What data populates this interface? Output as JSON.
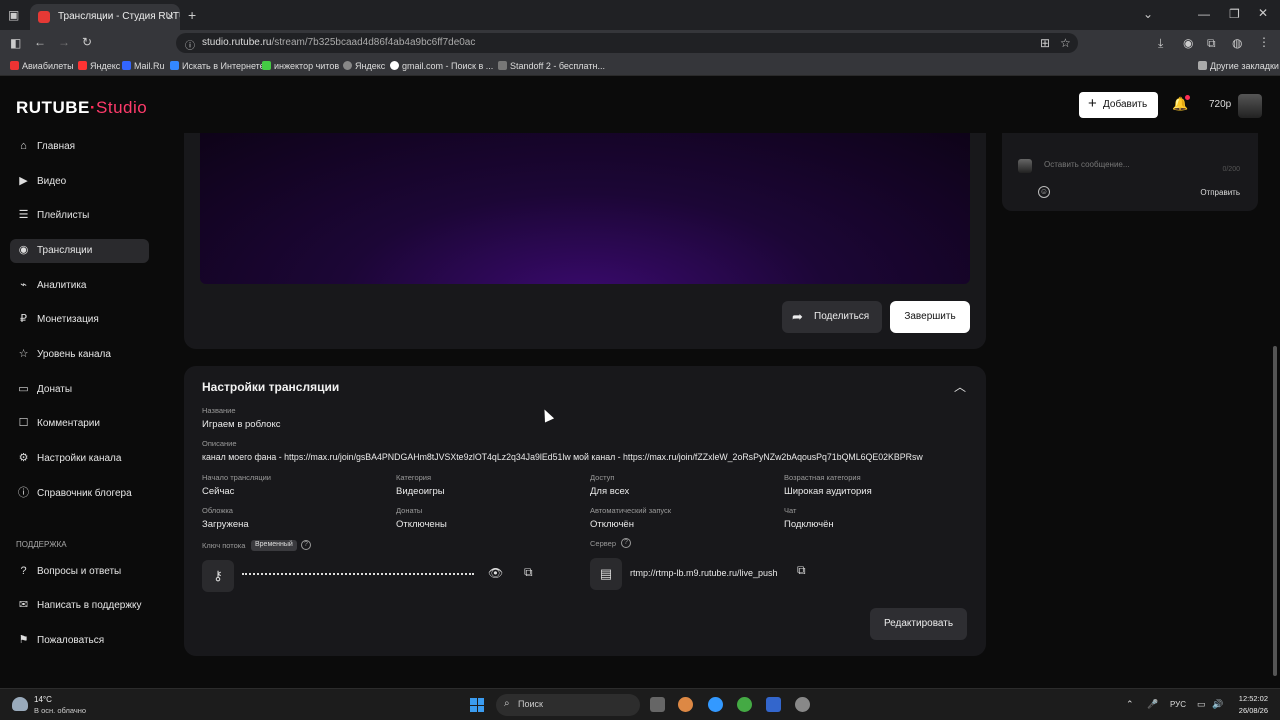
{
  "browser": {
    "tab_title": "Трансляции - Студия RUTUBE",
    "url_domain": "studio.rutube.ru",
    "url_path": "/stream/7b325bcaad4d86f4ab4a9bc6ff7de0ac",
    "bookmarks": [
      "Авиабилеты",
      "Яндекс",
      "Mail.Ru",
      "Искать в Интернете",
      "инжектор читов",
      "Яндекс",
      "gmail.com - Поиск в ...",
      "Standoff 2 - бесплатн..."
    ],
    "other_bookmarks": "Другие закладки"
  },
  "app": {
    "logo_main": "RUTUBE",
    "logo_dot": "·",
    "logo_studio": "Studio",
    "add_label": "Добавить",
    "quality": "720p"
  },
  "sidebar": {
    "items": [
      {
        "label": "Главная",
        "icon": "home-icon"
      },
      {
        "label": "Видео",
        "icon": "video-icon"
      },
      {
        "label": "Плейлисты",
        "icon": "playlist-icon"
      },
      {
        "label": "Трансляции",
        "icon": "broadcast-icon",
        "active": true
      },
      {
        "label": "Аналитика",
        "icon": "analytics-icon"
      },
      {
        "label": "Монетизация",
        "icon": "money-icon"
      },
      {
        "label": "Уровень канала",
        "icon": "star-icon"
      },
      {
        "label": "Донаты",
        "icon": "donate-icon"
      },
      {
        "label": "Комментарии",
        "icon": "comment-icon"
      },
      {
        "label": "Настройки канала",
        "icon": "gear-icon"
      },
      {
        "label": "Справочник блогера",
        "icon": "info-icon"
      }
    ],
    "support_heading": "ПОДДЕРЖКА",
    "support_items": [
      {
        "label": "Вопросы и ответы",
        "icon": "question-icon"
      },
      {
        "label": "Написать в поддержку",
        "icon": "mail-icon"
      },
      {
        "label": "Пожаловаться",
        "icon": "flag-icon"
      }
    ]
  },
  "stream": {
    "share_label": "Поделиться",
    "finish_label": "Завершить"
  },
  "settings": {
    "title": "Настройки трансляции",
    "name_label": "Название",
    "name_value": "Играем в роблокс",
    "desc_label": "Описание",
    "desc_value": "канал моего фана - https://max.ru/join/gsBA4PNDGAHm8tJVSXte9zlOT4qLz2q34Ja9lEd51lw мой канал - https://max.ru/join/fZZxleW_2oRsPyNZw2bAqousPq71bQML6QE02KBPRsw",
    "fields": [
      {
        "label": "Начало трансляции",
        "value": "Сейчас"
      },
      {
        "label": "Категория",
        "value": "Видеоигры"
      },
      {
        "label": "Доступ",
        "value": "Для всех"
      },
      {
        "label": "Возрастная категория",
        "value": "Широкая аудитория"
      },
      {
        "label": "Обложка",
        "value": "Загружена"
      },
      {
        "label": "Донаты",
        "value": "Отключены"
      },
      {
        "label": "Автоматический запуск",
        "value": "Отключён"
      },
      {
        "label": "Чат",
        "value": "Подключён"
      }
    ],
    "key_label": "Ключ потока",
    "key_badge": "Временный",
    "server_label": "Сервер",
    "server_value": "rtmp://rtmp-lb.m9.rutube.ru/live_push",
    "edit_label": "Редактировать"
  },
  "chat": {
    "placeholder": "Оставить сообщение...",
    "counter": "0/200",
    "send_label": "Отправить"
  },
  "taskbar": {
    "temp": "14°C",
    "weather": "В осн. облачно",
    "search_label": "Поиск",
    "lang": "РУС",
    "time": "12:52:02",
    "date": "26/08/26"
  }
}
